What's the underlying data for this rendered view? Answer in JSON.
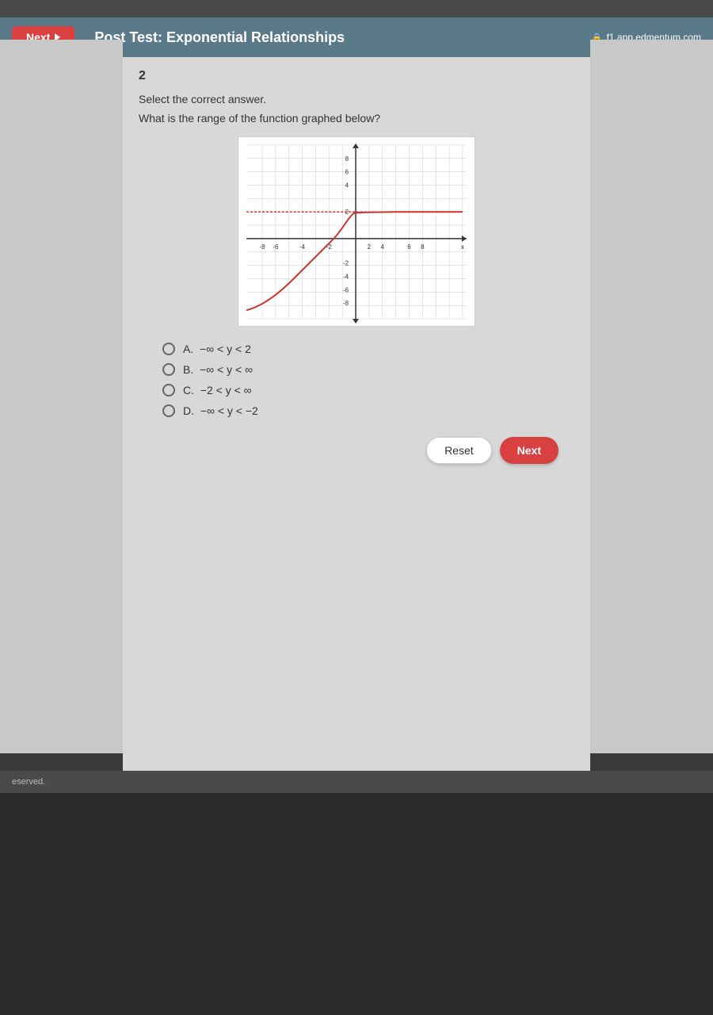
{
  "topbar": {
    "label": ""
  },
  "navbar": {
    "next_label": "Next",
    "title": "Post Test: Exponential Relationships",
    "url": "f1.app.edmentum.com",
    "lock_icon": "🔒"
  },
  "question": {
    "number": "2",
    "instruction": "Select the correct answer.",
    "text": "What is the range of the function graphed below?",
    "options": [
      {
        "label": "A.",
        "value": "-∞ < y < 2"
      },
      {
        "label": "B.",
        "value": "-∞ < y < ∞"
      },
      {
        "label": "C.",
        "value": "-2 < y < ∞"
      },
      {
        "label": "D.",
        "value": "-∞ < y < -2"
      }
    ]
  },
  "buttons": {
    "reset": "Reset",
    "next": "Next"
  },
  "footer": {
    "text": "eserved."
  },
  "graph": {
    "x_labels": [
      "-8",
      "-6",
      "-4",
      "-2",
      "2",
      "4",
      "6",
      "8"
    ],
    "y_labels": [
      "8",
      "6",
      "4",
      "2",
      "-2",
      "-4",
      "-6",
      "-8"
    ]
  }
}
